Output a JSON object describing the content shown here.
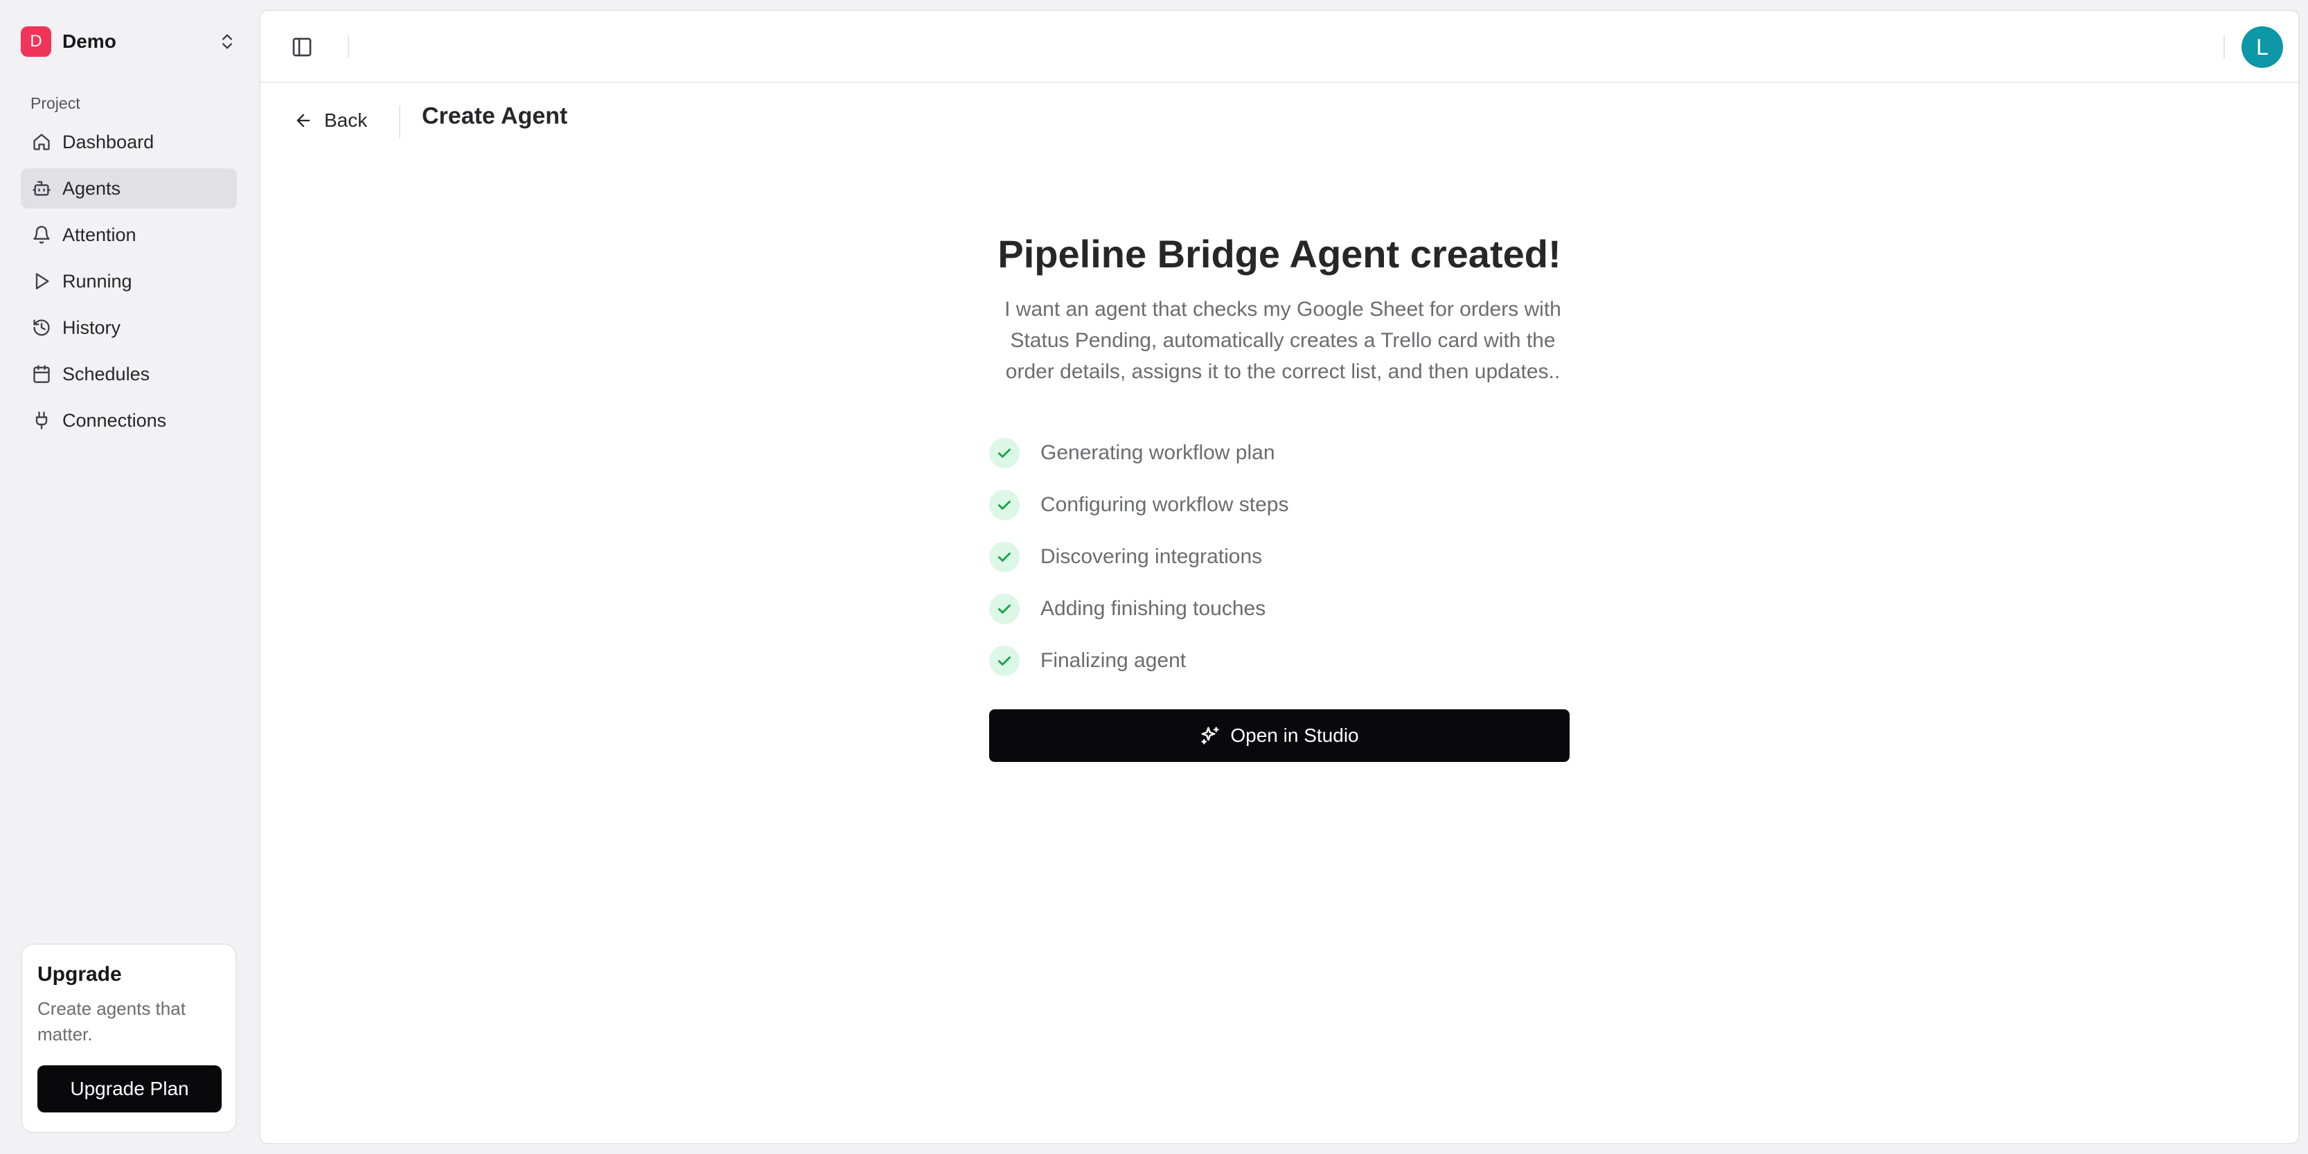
{
  "sidebar": {
    "workspace": {
      "initial": "D",
      "name": "Demo"
    },
    "section_label": "Project",
    "items": [
      {
        "label": "Dashboard",
        "icon": "home-icon"
      },
      {
        "label": "Agents",
        "icon": "bot-icon",
        "active": true
      },
      {
        "label": "Attention",
        "icon": "bell-icon"
      },
      {
        "label": "Running",
        "icon": "play-icon"
      },
      {
        "label": "History",
        "icon": "history-icon"
      },
      {
        "label": "Schedules",
        "icon": "calendar-icon"
      },
      {
        "label": "Connections",
        "icon": "plug-icon"
      }
    ],
    "upgrade": {
      "title": "Upgrade",
      "description": "Create agents that matter.",
      "button_label": "Upgrade Plan"
    }
  },
  "topbar": {
    "avatar_initial": "L"
  },
  "header": {
    "back_label": "Back",
    "title": "Create Agent"
  },
  "main": {
    "headline": "Pipeline Bridge Agent created!",
    "prompt": "I want an agent that checks my Google Sheet for orders with Status Pending, automatically creates a Trello card with the order details, assigns it to the correct list, and then updates..",
    "steps": [
      {
        "label": "Generating workflow plan",
        "done": true
      },
      {
        "label": "Configuring workflow steps",
        "done": true
      },
      {
        "label": "Discovering integrations",
        "done": true
      },
      {
        "label": "Adding finishing touches",
        "done": true
      },
      {
        "label": "Finalizing agent",
        "done": true
      }
    ],
    "open_button_label": "Open in Studio"
  },
  "colors": {
    "brand_logo": "#f0345a",
    "avatar": "#0e97a6",
    "check_bg": "#dcf7e6",
    "check_stroke": "#16a34a",
    "primary_button": "#09090b"
  }
}
